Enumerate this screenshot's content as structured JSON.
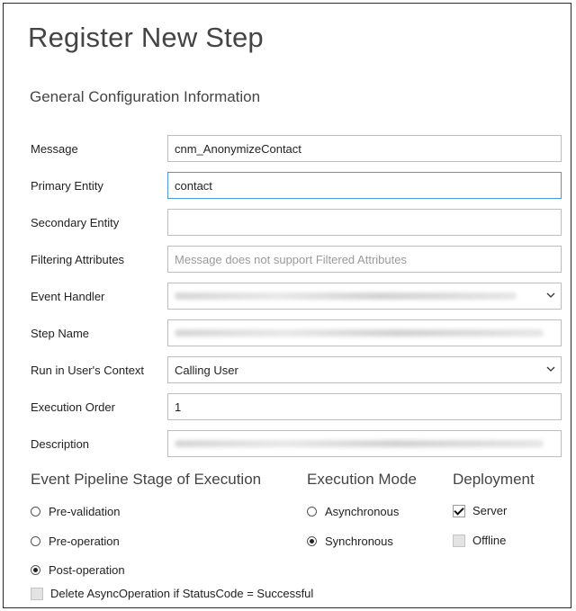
{
  "dialog": {
    "title": "Register New Step",
    "subtitle": "General Configuration Information"
  },
  "form": {
    "message": {
      "label": "Message",
      "value": "cnm_AnonymizeContact"
    },
    "primary_entity": {
      "label": "Primary Entity",
      "value": "contact"
    },
    "secondary_entity": {
      "label": "Secondary Entity",
      "value": ""
    },
    "filtering_attributes": {
      "label": "Filtering Attributes",
      "value": "Message does not support Filtered Attributes"
    },
    "event_handler": {
      "label": "Event Handler",
      "value": ""
    },
    "step_name": {
      "label": "Step Name",
      "value": ""
    },
    "run_context": {
      "label": "Run in User's Context",
      "value": "Calling User"
    },
    "execution_order": {
      "label": "Execution Order",
      "value": "1"
    },
    "description": {
      "label": "Description",
      "value": ""
    }
  },
  "pipeline": {
    "heading": "Event Pipeline Stage of Execution",
    "options": [
      {
        "label": "Pre-validation",
        "selected": false
      },
      {
        "label": "Pre-operation",
        "selected": false
      },
      {
        "label": "Post-operation",
        "selected": true
      }
    ]
  },
  "execution_mode": {
    "heading": "Execution Mode",
    "options": [
      {
        "label": "Asynchronous",
        "selected": false
      },
      {
        "label": "Synchronous",
        "selected": true
      }
    ]
  },
  "deployment": {
    "heading": "Deployment",
    "options": [
      {
        "label": "Server",
        "checked": true
      },
      {
        "label": "Offline",
        "checked": false
      }
    ]
  },
  "delete_async": {
    "label": "Delete AsyncOperation if StatusCode = Successful",
    "checked": false
  }
}
